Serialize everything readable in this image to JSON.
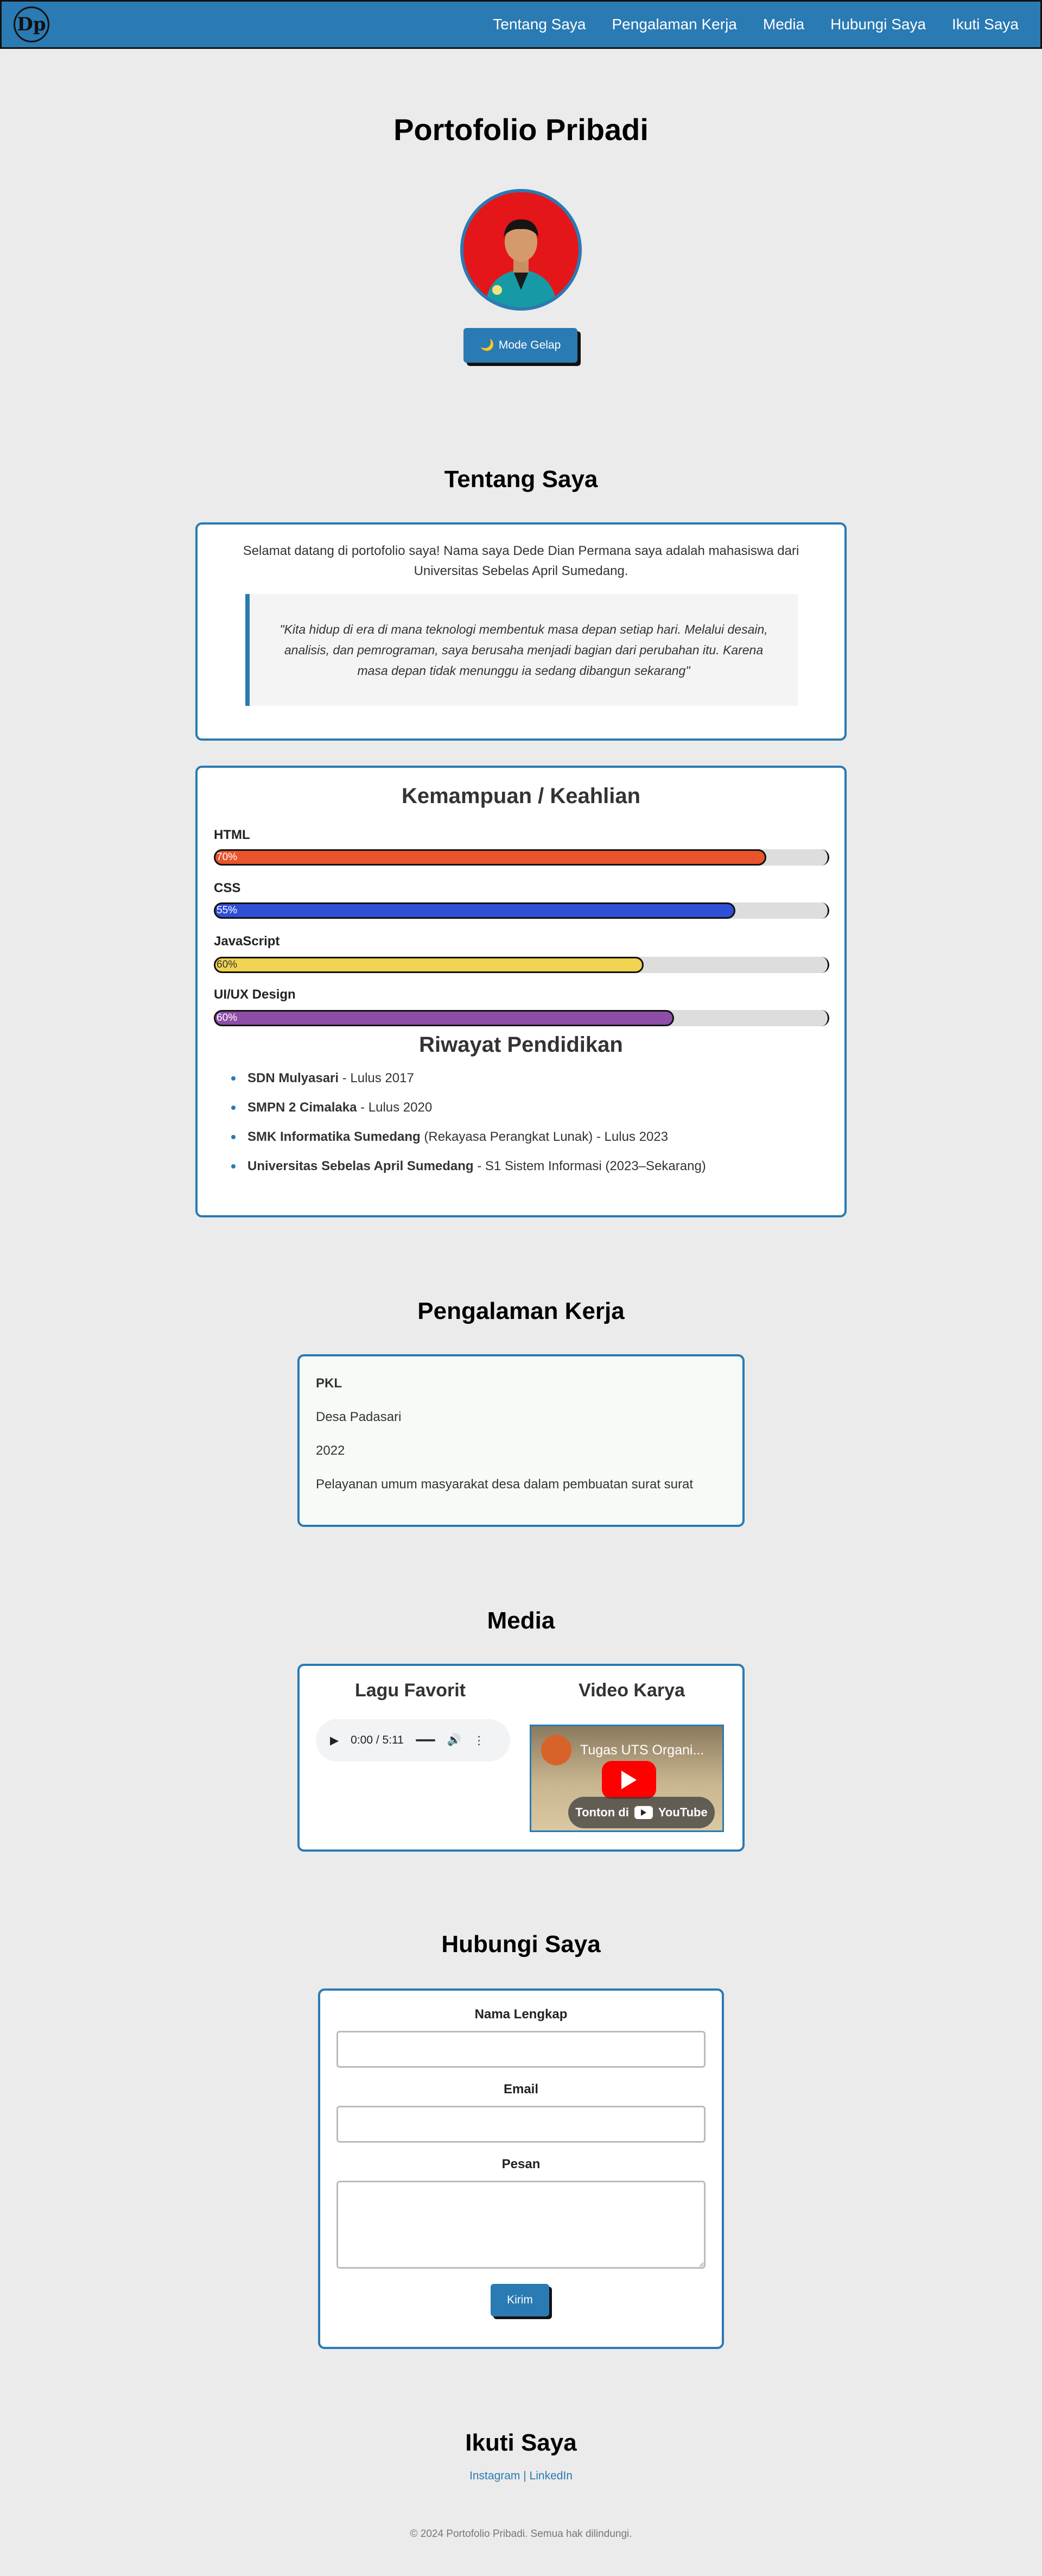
{
  "nav": {
    "logo_text": "Dp",
    "links": [
      "Tentang Saya",
      "Pengalaman Kerja",
      "Media",
      "Hubungi Saya",
      "Ikuti Saya"
    ]
  },
  "hero": {
    "title": "Portofolio Pribadi",
    "theme_icon": "moon-icon",
    "theme_button": "Mode Gelap"
  },
  "about": {
    "title": "Tentang Saya",
    "intro": "Selamat datang di portofolio saya! Nama saya Dede Dian Permana saya adalah mahasiswa dari Universitas Sebelas April Sumedang.",
    "quote": "\"Kita hidup di era di mana teknologi membentuk masa depan setiap hari. Melalui desain, analisis, dan pemrograman, saya berusaha menjadi bagian dari perubahan itu. Karena masa depan tidak menunggu ia sedang dibangun sekarang\""
  },
  "skills": {
    "title": "Kemampuan / Keahlian",
    "items": [
      {
        "name": "HTML",
        "percent_label": "70%",
        "fill_fraction": 0.9,
        "color": "#e9542c"
      },
      {
        "name": "CSS",
        "percent_label": "55%",
        "fill_fraction": 0.85,
        "color": "#2f4fd6"
      },
      {
        "name": "JavaScript",
        "percent_label": "60%",
        "fill_fraction": 0.7,
        "color": "#f0d350"
      },
      {
        "name": "UI/UX Design",
        "percent_label": "60%",
        "fill_fraction": 0.75,
        "color": "#8d4ea8"
      }
    ]
  },
  "education": {
    "title": "Riwayat Pendidikan",
    "items": [
      {
        "school": "SDN Mulyasari",
        "detail": " - Lulus 2017"
      },
      {
        "school": "SMPN 2 Cimalaka",
        "detail": " - Lulus 2020"
      },
      {
        "school": "SMK Informatika Sumedang",
        "detail": " (Rekayasa Perangkat Lunak) - Lulus 2023"
      },
      {
        "school": "Universitas Sebelas April Sumedang",
        "detail": " - S1 Sistem Informasi (2023–Sekarang)"
      }
    ]
  },
  "work": {
    "title": "Pengalaman Kerja",
    "role": "PKL",
    "place": "Desa Padasari",
    "year": "2022",
    "description": "Pelayanan umum masyarakat desa dalam pembuatan surat surat"
  },
  "media": {
    "title": "Media",
    "song_heading": "Lagu Favorit",
    "audio_time": "0:00 / 5:11",
    "video_heading": "Video Karya",
    "video_title": "Tugas UTS Organi...",
    "video_watch": "Tonton di",
    "video_brand": "YouTube"
  },
  "contact": {
    "title": "Hubungi Saya",
    "name_label": "Nama Lengkap",
    "email_label": "Email",
    "message_label": "Pesan",
    "submit": "Kirim"
  },
  "follow": {
    "title": "Ikuti Saya",
    "instagram": "Instagram",
    "separator": " | ",
    "linkedin": "LinkedIn"
  },
  "footer": {
    "text": "© 2024 Portofolio Pribadi. Semua hak dilindungi."
  }
}
